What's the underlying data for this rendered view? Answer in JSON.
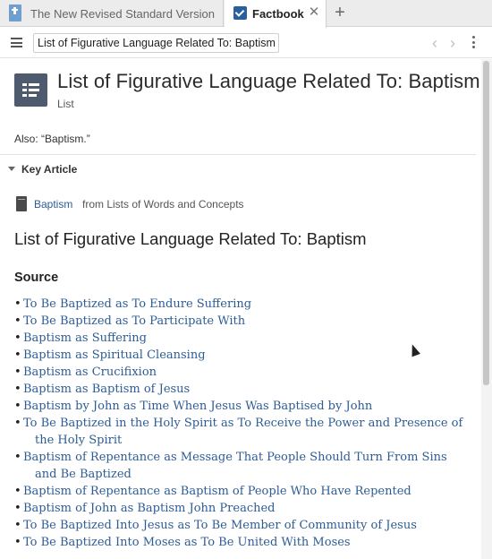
{
  "tabs": [
    {
      "label": "The New Revised Standard Version",
      "active": false,
      "icon": "bible-icon"
    },
    {
      "label": "Factbook",
      "active": true,
      "icon": "factbook-check-icon"
    }
  ],
  "toolbar": {
    "title_value": "List of Figurative Language Related To: Baptism",
    "menu_icon": "hamburger-icon",
    "back_icon": "chevron-left-icon",
    "forward_icon": "chevron-right-icon",
    "more_icon": "kebab-icon"
  },
  "header": {
    "title": "List of Figurative Language Related To: Baptism",
    "subtitle": "List",
    "icon": "list-icon"
  },
  "also": "Also: “Baptism.”",
  "key_article": {
    "section_title": "Key Article",
    "link_label": "Baptism",
    "source_label": "from Lists of Words and Concepts",
    "heading": "List of Figurative Language Related To: Baptism",
    "source_heading": "Source",
    "items": [
      {
        "lines": [
          "To Be Baptized as To Endure Suffering"
        ]
      },
      {
        "lines": [
          "To Be Baptized as To Participate With"
        ]
      },
      {
        "lines": [
          "Baptism as Suffering"
        ]
      },
      {
        "lines": [
          "Baptism as Spiritual Cleansing"
        ]
      },
      {
        "lines": [
          "Baptism as Crucifixion"
        ]
      },
      {
        "lines": [
          "Baptism as Baptism of Jesus"
        ]
      },
      {
        "lines": [
          "Baptism by John as Time When Jesus Was Baptised by John"
        ]
      },
      {
        "lines": [
          "To Be Baptized in the Holy Spirit as To Receive the Power and Presence of",
          "the Holy Spirit"
        ]
      },
      {
        "lines": [
          "Baptism of Repentance as Message That People Should Turn From Sins",
          "and Be Baptized"
        ]
      },
      {
        "lines": [
          "Baptism of Repentance as Baptism of People Who Have Repented"
        ]
      },
      {
        "lines": [
          "Baptism of John as Baptism John Preached"
        ]
      },
      {
        "lines": [
          "To Be Baptized Into Jesus as To Be Member of Community of Jesus"
        ]
      },
      {
        "lines": [
          "To Be Baptized Into Moses as To Be United With Moses"
        ]
      }
    ]
  },
  "colors": {
    "link": "#2d5c95",
    "icon_bg": "#4e5b6e",
    "tab_check": "#2a5f9e"
  }
}
